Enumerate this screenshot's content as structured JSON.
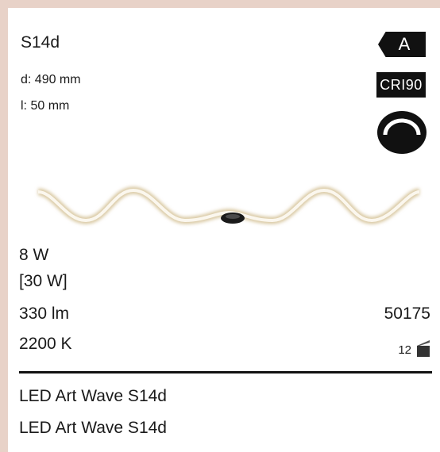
{
  "product": {
    "base": "S14d",
    "diameter": "d: 490 mm",
    "length": "l:  50 mm",
    "power": "8 W",
    "power_equivalent": "[30 W]",
    "lumen": "330 lm",
    "color_temperature": "2200 K",
    "code": "50175",
    "pack_quantity": "12",
    "name_line1": "LED Art Wave S14d",
    "name_line2": "LED Art Wave S14d"
  },
  "badges": {
    "energy_class": "A",
    "cri": "CRI90",
    "dimmer_icon": "dimmable-icon",
    "box_icon": "box-icon"
  },
  "colors": {
    "background_frame": "#e8d2c8",
    "badge": "#111111",
    "filament": "#f2e6c8"
  }
}
